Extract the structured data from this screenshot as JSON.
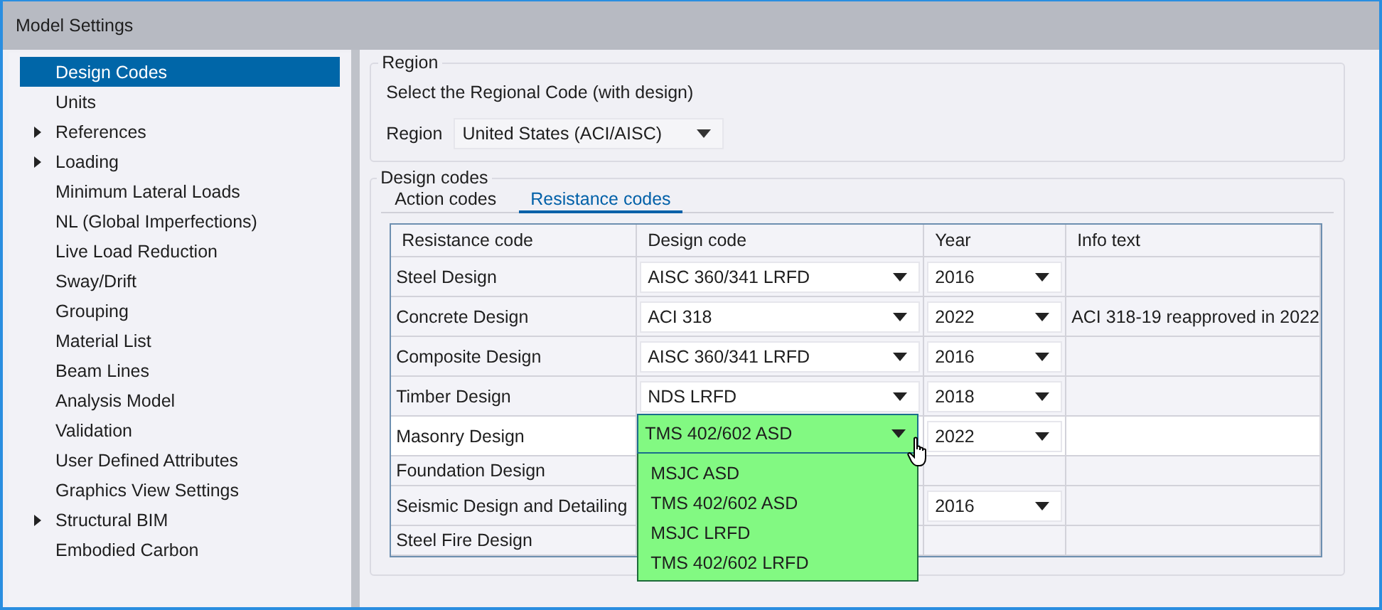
{
  "window": {
    "title": "Model Settings"
  },
  "sidebar": {
    "items": [
      {
        "label": "Design Codes",
        "selected": true,
        "expandable": false
      },
      {
        "label": "Units",
        "selected": false,
        "expandable": false
      },
      {
        "label": "References",
        "selected": false,
        "expandable": true
      },
      {
        "label": "Loading",
        "selected": false,
        "expandable": true
      },
      {
        "label": "Minimum Lateral Loads",
        "selected": false,
        "expandable": false
      },
      {
        "label": "NL (Global Imperfections)",
        "selected": false,
        "expandable": false
      },
      {
        "label": "Live Load Reduction",
        "selected": false,
        "expandable": false
      },
      {
        "label": "Sway/Drift",
        "selected": false,
        "expandable": false
      },
      {
        "label": "Grouping",
        "selected": false,
        "expandable": false
      },
      {
        "label": "Material List",
        "selected": false,
        "expandable": false
      },
      {
        "label": "Beam Lines",
        "selected": false,
        "expandable": false
      },
      {
        "label": "Analysis Model",
        "selected": false,
        "expandable": false
      },
      {
        "label": "Validation",
        "selected": false,
        "expandable": false
      },
      {
        "label": "User Defined Attributes",
        "selected": false,
        "expandable": false
      },
      {
        "label": "Graphics View Settings",
        "selected": false,
        "expandable": false
      },
      {
        "label": "Structural BIM",
        "selected": false,
        "expandable": true
      },
      {
        "label": "Embodied Carbon",
        "selected": false,
        "expandable": false
      }
    ]
  },
  "region": {
    "title": "Region",
    "instruction": "Select the Regional Code (with design)",
    "label": "Region",
    "value": "United States (ACI/AISC)"
  },
  "design_codes": {
    "title": "Design codes",
    "tabs": [
      {
        "label": "Action codes",
        "selected": false
      },
      {
        "label": "Resistance codes",
        "selected": true
      }
    ],
    "table": {
      "columns": [
        "Resistance code",
        "Design code",
        "Year",
        "Info text"
      ],
      "rows": [
        {
          "resistance_code": "Steel Design",
          "design_code": "AISC 360/341 LRFD",
          "year": "2016",
          "selected": false
        },
        {
          "resistance_code": "Concrete Design",
          "design_code": "ACI 318",
          "year": "2022",
          "info": "ACI 318-19 reapproved in 2022",
          "selected": false
        },
        {
          "resistance_code": "Composite Design",
          "design_code": "AISC 360/341 LRFD",
          "year": "2016",
          "selected": false
        },
        {
          "resistance_code": "Timber Design",
          "design_code": "NDS LRFD",
          "year": "2018",
          "selected": false
        },
        {
          "resistance_code": "Masonry Design",
          "design_code": "TMS 402/602 ASD",
          "year": "2022",
          "selected": true,
          "open": true,
          "options": [
            "MSJC ASD",
            "TMS 402/602 ASD",
            "MSJC LRFD",
            "TMS 402/602 LRFD"
          ]
        },
        {
          "resistance_code": "Foundation Design",
          "selected": false
        },
        {
          "resistance_code": "Seismic Design and Detailing",
          "year": "2016",
          "selected": false
        },
        {
          "resistance_code": "Steel Fire Design",
          "selected": false
        }
      ]
    }
  }
}
